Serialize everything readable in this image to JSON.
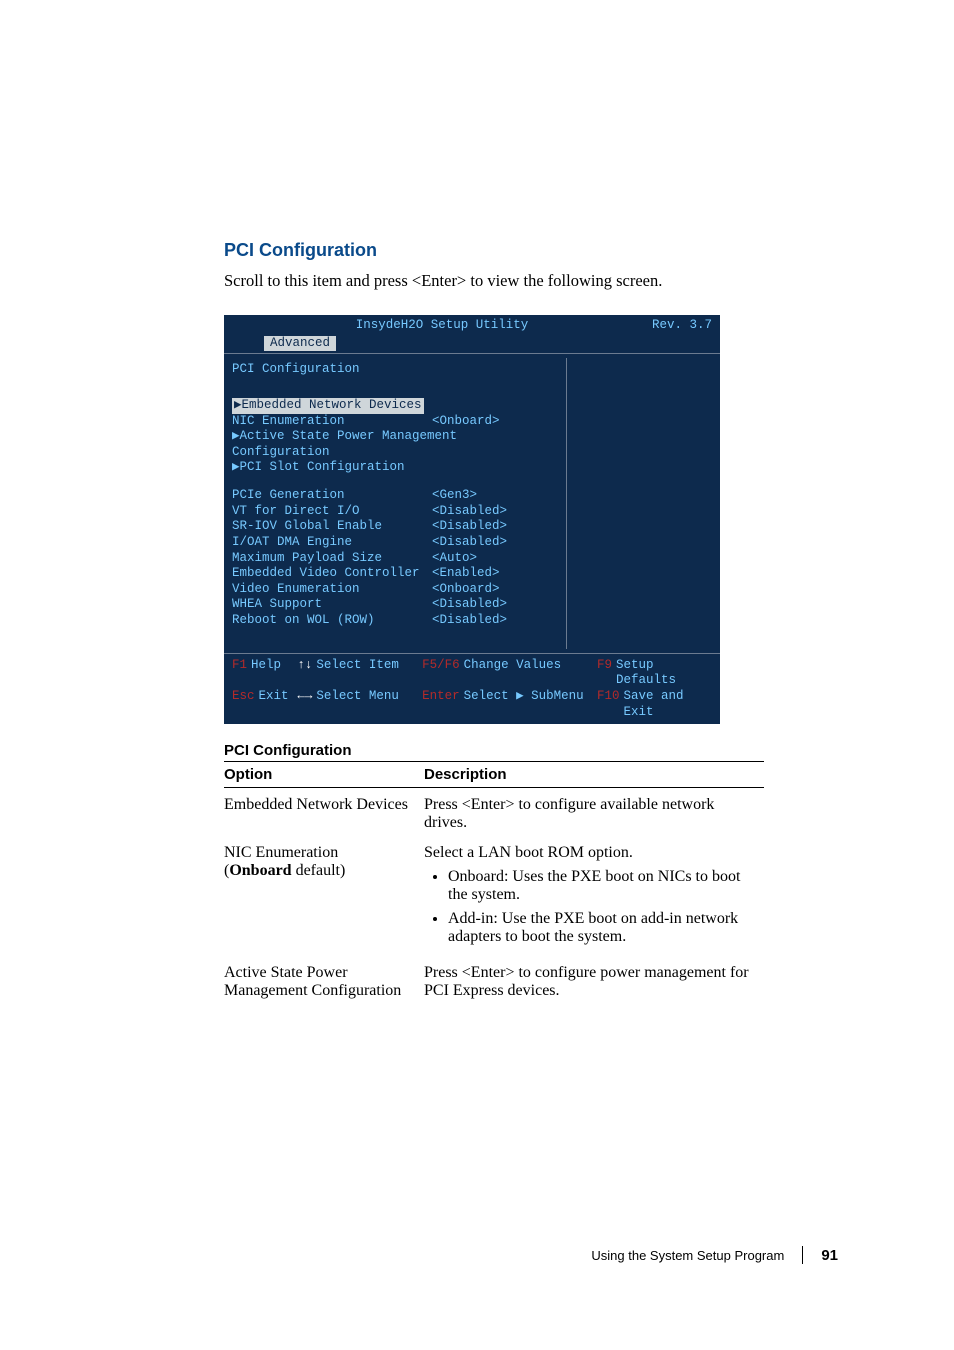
{
  "section_title": "PCI Configuration",
  "intro": "Scroll to this item and press <Enter> to view the following screen.",
  "bios": {
    "top_title": "InsydeH2O Setup Utility",
    "rev": "Rev. 3.7",
    "tab": "Advanced",
    "heading": "PCI Configuration",
    "selected": "▶Embedded Network Devices",
    "lines": [
      {
        "label": "NIC Enumeration",
        "value": "<Onboard>"
      },
      {
        "label": "▶Active State Power Management Configuration",
        "value": ""
      },
      {
        "label": "▶PCI Slot Configuration",
        "value": ""
      }
    ],
    "lines2": [
      {
        "label": "PCIe Generation",
        "value": "<Gen3>"
      },
      {
        "label": "VT for Direct I/O",
        "value": "<Disabled>"
      },
      {
        "label": "SR-IOV Global Enable",
        "value": "<Disabled>"
      },
      {
        "label": "I/OAT DMA Engine",
        "value": "<Disabled>"
      },
      {
        "label": "Maximum Payload Size",
        "value": "<Auto>"
      },
      {
        "label": "Embedded Video Controller",
        "value": "<Enabled>"
      },
      {
        "label": "Video Enumeration",
        "value": "<Onboard>"
      },
      {
        "label": "WHEA Support",
        "value": "<Disabled>"
      },
      {
        "label": "Reboot on WOL (ROW)",
        "value": "<Disabled>"
      }
    ],
    "footer": {
      "l1a_key": "F1",
      "l1a_txt": "Help",
      "l1b_arrow": "↑↓",
      "l1b_txt": "Select Item",
      "l1c_key": "F5/F6",
      "l1c_txt": "Change Values",
      "l1d_key": "F9",
      "l1d_txt": "Setup Defaults",
      "l2a_key": "Esc",
      "l2a_txt": "Exit",
      "l2b_arrow": "←→",
      "l2b_txt": "Select Menu",
      "l2c_key": "Enter",
      "l2c_txt": "Select ▶ SubMenu",
      "l2d_key": "F10",
      "l2d_txt": "Save and Exit"
    }
  },
  "table": {
    "caption": "PCI Configuration",
    "h_option": "Option",
    "h_desc": "Description",
    "r0_opt": "Embedded Network Devices",
    "r0_desc": "Press <Enter> to configure available network drives.",
    "r1_opt_l1": "NIC Enumeration",
    "r1_opt_l2": "(Onboard default)",
    "r1_desc": "Select a LAN boot ROM option.",
    "r1_b1": "Onboard: Uses the PXE boot on NICs to boot the system.",
    "r1_b2": "Add-in: Use the PXE boot on add-in network adapters to boot the system.",
    "r2_opt_l1": "Active State Power",
    "r2_opt_l2": "Management Configuration",
    "r2_desc": "Press <Enter> to configure power management for PCI Express devices."
  },
  "footer": {
    "text": "Using the System Setup Program",
    "page": "91"
  }
}
